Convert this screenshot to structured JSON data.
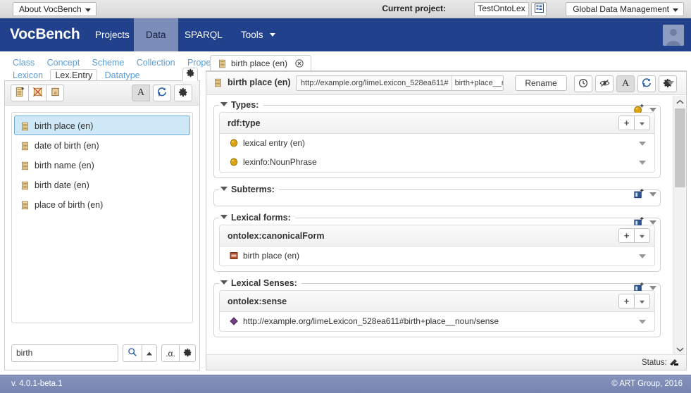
{
  "topbar": {
    "about_label": "About VocBench",
    "current_project_label": "Current project:",
    "project_name": "TestOntoLex",
    "project_icon": "list-icon",
    "data_management_label": "Global Data Management"
  },
  "navbar": {
    "brand": "VocBench",
    "items": [
      {
        "label": "Projects",
        "active": false,
        "caret": false
      },
      {
        "label": "Data",
        "active": true,
        "caret": false
      },
      {
        "label": "SPARQL",
        "active": false,
        "caret": false
      },
      {
        "label": "Tools",
        "active": false,
        "caret": true
      }
    ],
    "avatar_icon": "user-avatar-icon",
    "nav_bg": "#21418d",
    "nav_active_bg": "#7d8dba"
  },
  "left_panel": {
    "tabs_row1": [
      {
        "label": "Class",
        "active": false
      },
      {
        "label": "Concept",
        "active": false
      },
      {
        "label": "Scheme",
        "active": false
      },
      {
        "label": "Collection",
        "active": false
      },
      {
        "label": "Property",
        "active": false
      }
    ],
    "tabs_row2": [
      {
        "label": "Lexicon",
        "active": false
      },
      {
        "label": "Lex.Entry",
        "active": true
      },
      {
        "label": "Datatype",
        "active": false
      }
    ],
    "tabs_settings_icon": "gear-icon",
    "toolbar_left": [
      {
        "icon": "add-lexical-entry-icon",
        "name": "create-entry-button"
      },
      {
        "icon": "delete-entry-icon",
        "name": "delete-entry-button"
      },
      {
        "icon": "edit-entry-icon",
        "name": "edit-entry-button"
      }
    ],
    "toolbar_right": [
      {
        "icon": "alphabetical-sort-icon",
        "name": "alphabetical-toggle-button",
        "label": "A",
        "pressed": true
      },
      {
        "icon": "refresh-icon",
        "name": "refresh-button",
        "pressed": false
      },
      {
        "icon": "gear-icon",
        "name": "panel-settings-button",
        "pressed": false
      }
    ],
    "entries": [
      {
        "label": "birth place (en)",
        "selected": true
      },
      {
        "label": "date of birth (en)",
        "selected": false
      },
      {
        "label": "birth name (en)",
        "selected": false
      },
      {
        "label": "birth date (en)",
        "selected": false
      },
      {
        "label": "place of birth (en)",
        "selected": false
      }
    ],
    "search": {
      "value": "birth",
      "placeholder": "",
      "search_icon": "magnifier-icon",
      "up_icon": "caret-up-icon",
      "alpha_label": ".α.",
      "settings_icon": "gear-icon"
    },
    "selected_bg": "#cfe8f7",
    "selected_border": "#6eaed6",
    "tab_link_color": "#5b9bd5"
  },
  "right_panel": {
    "tab": {
      "label": "birth place (en)",
      "icon": "lexical-entry-icon",
      "close_icon": "close-circle-icon"
    },
    "resource_header": {
      "title": "birth place (en)",
      "title_icon": "lexical-entry-icon",
      "uri_namespace": "http://example.org/limeLexicon_528ea611#",
      "uri_localname": "birth+place__noun.",
      "uri_edit_icon": "edit-pencil-icon",
      "rename_label": "Rename",
      "buttons": [
        {
          "icon": "history-clock-icon",
          "name": "history-button",
          "pressed": false
        },
        {
          "icon": "validation-eye-icon",
          "name": "validation-button",
          "pressed": false
        },
        {
          "icon": "show-labels-icon",
          "name": "labels-toggle-button",
          "label": "A",
          "pressed": true
        },
        {
          "icon": "refresh-icon",
          "name": "refresh-button",
          "pressed": false
        },
        {
          "icon": "gear-icon",
          "name": "settings-button",
          "pressed": false
        }
      ],
      "overflow_icon": "caret-down-icon"
    },
    "sections": [
      {
        "title": "Types:",
        "add_icon": "add-individual-icon",
        "add_icon_color": "#d9a410",
        "empty": false,
        "predicates": [
          {
            "name": "rdf:type",
            "add_label": "+",
            "menu_icon": "caret-down-icon",
            "objects": [
              {
                "label": "lexical entry (en)",
                "icon": "individual-icon",
                "icon_color": "#d9a410"
              },
              {
                "label": "lexinfo:NounPhrase",
                "icon": "individual-icon",
                "icon_color": "#d9a410"
              }
            ]
          }
        ]
      },
      {
        "title": "Subterms:",
        "add_icon": "add-resource-icon",
        "add_icon_color": "#2a5699",
        "empty": true,
        "predicates": []
      },
      {
        "title": "Lexical forms:",
        "add_icon": "add-resource-icon",
        "add_icon_color": "#2a5699",
        "empty": false,
        "predicates": [
          {
            "name": "ontolex:canonicalForm",
            "add_label": "+",
            "menu_icon": "caret-down-icon",
            "objects": [
              {
                "label": "birth place (en)",
                "icon": "form-icon",
                "icon_color": "#b0502a"
              }
            ]
          }
        ]
      },
      {
        "title": "Lexical Senses:",
        "add_icon": "add-resource-icon",
        "add_icon_color": "#2a5699",
        "empty": false,
        "predicates": [
          {
            "name": "ontolex:sense",
            "add_label": "+",
            "menu_icon": "caret-down-icon",
            "objects": [
              {
                "label": "http://example.org/limeLexicon_528ea611#birth+place__noun/sense",
                "icon": "sense-diamond-icon",
                "icon_color": "#7a3b86"
              }
            ]
          }
        ]
      }
    ],
    "scrollbar": {
      "up_icon": "chevron-up-icon",
      "down_icon": "chevron-down-icon"
    },
    "status": {
      "label": "Status:",
      "icon": "status-icon"
    }
  },
  "footer": {
    "version": "v. 4.0.1-beta.1",
    "copyright": "© ART Group, 2016",
    "bg": "#7d8bb6"
  }
}
